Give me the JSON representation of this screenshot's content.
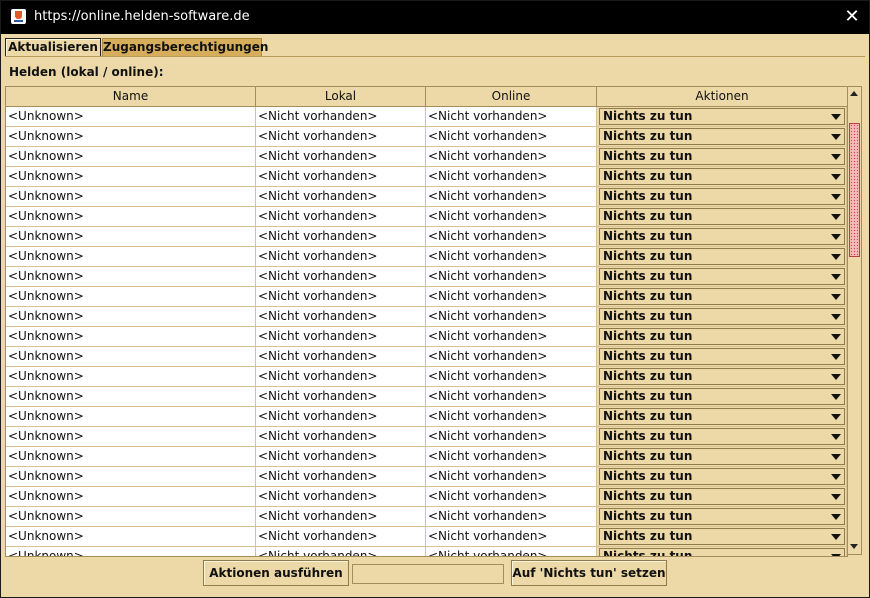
{
  "window": {
    "title": "https://online.helden-software.de"
  },
  "tabs": [
    {
      "label": "Aktualisieren",
      "active": true
    },
    {
      "label": "Zugangsberechtigungen",
      "active": false
    }
  ],
  "panel": {
    "label": "Helden (lokal / online):"
  },
  "table": {
    "columns": [
      "Name",
      "Lokal",
      "Online",
      "Aktionen"
    ],
    "rows": [
      {
        "name": "<Unknown>",
        "lokal": "<Nicht vorhanden>",
        "online": "<Nicht vorhanden>",
        "action": "Nichts zu tun"
      },
      {
        "name": "<Unknown>",
        "lokal": "<Nicht vorhanden>",
        "online": "<Nicht vorhanden>",
        "action": "Nichts zu tun"
      },
      {
        "name": "<Unknown>",
        "lokal": "<Nicht vorhanden>",
        "online": "<Nicht vorhanden>",
        "action": "Nichts zu tun"
      },
      {
        "name": "<Unknown>",
        "lokal": "<Nicht vorhanden>",
        "online": "<Nicht vorhanden>",
        "action": "Nichts zu tun"
      },
      {
        "name": "<Unknown>",
        "lokal": "<Nicht vorhanden>",
        "online": "<Nicht vorhanden>",
        "action": "Nichts zu tun"
      },
      {
        "name": "<Unknown>",
        "lokal": "<Nicht vorhanden>",
        "online": "<Nicht vorhanden>",
        "action": "Nichts zu tun"
      },
      {
        "name": "<Unknown>",
        "lokal": "<Nicht vorhanden>",
        "online": "<Nicht vorhanden>",
        "action": "Nichts zu tun"
      },
      {
        "name": "<Unknown>",
        "lokal": "<Nicht vorhanden>",
        "online": "<Nicht vorhanden>",
        "action": "Nichts zu tun"
      },
      {
        "name": "<Unknown>",
        "lokal": "<Nicht vorhanden>",
        "online": "<Nicht vorhanden>",
        "action": "Nichts zu tun"
      },
      {
        "name": "<Unknown>",
        "lokal": "<Nicht vorhanden>",
        "online": "<Nicht vorhanden>",
        "action": "Nichts zu tun"
      },
      {
        "name": "<Unknown>",
        "lokal": "<Nicht vorhanden>",
        "online": "<Nicht vorhanden>",
        "action": "Nichts zu tun"
      },
      {
        "name": "<Unknown>",
        "lokal": "<Nicht vorhanden>",
        "online": "<Nicht vorhanden>",
        "action": "Nichts zu tun"
      },
      {
        "name": "<Unknown>",
        "lokal": "<Nicht vorhanden>",
        "online": "<Nicht vorhanden>",
        "action": "Nichts zu tun"
      },
      {
        "name": "<Unknown>",
        "lokal": "<Nicht vorhanden>",
        "online": "<Nicht vorhanden>",
        "action": "Nichts zu tun"
      },
      {
        "name": "<Unknown>",
        "lokal": "<Nicht vorhanden>",
        "online": "<Nicht vorhanden>",
        "action": "Nichts zu tun"
      },
      {
        "name": "<Unknown>",
        "lokal": "<Nicht vorhanden>",
        "online": "<Nicht vorhanden>",
        "action": "Nichts zu tun"
      },
      {
        "name": "<Unknown>",
        "lokal": "<Nicht vorhanden>",
        "online": "<Nicht vorhanden>",
        "action": "Nichts zu tun"
      },
      {
        "name": "<Unknown>",
        "lokal": "<Nicht vorhanden>",
        "online": "<Nicht vorhanden>",
        "action": "Nichts zu tun"
      },
      {
        "name": "<Unknown>",
        "lokal": "<Nicht vorhanden>",
        "online": "<Nicht vorhanden>",
        "action": "Nichts zu tun"
      },
      {
        "name": "<Unknown>",
        "lokal": "<Nicht vorhanden>",
        "online": "<Nicht vorhanden>",
        "action": "Nichts zu tun"
      },
      {
        "name": "<Unknown>",
        "lokal": "<Nicht vorhanden>",
        "online": "<Nicht vorhanden>",
        "action": "Nichts zu tun"
      },
      {
        "name": "<Unknown>",
        "lokal": "<Nicht vorhanden>",
        "online": "<Nicht vorhanden>",
        "action": "Nichts zu tun"
      },
      {
        "name": "<Unknown>",
        "lokal": "<Nicht vorhanden>",
        "online": "<Nicht vorhanden>",
        "action": "Nichts zu tun"
      }
    ]
  },
  "buttons": {
    "execute": "Aktionen ausführen",
    "reset_all": "Auf 'Nichts tun' setzen"
  },
  "status_field": {
    "value": ""
  },
  "icons": {
    "app": "java-icon",
    "close": "close-icon"
  },
  "colors": {
    "panel": "#ecd9a7",
    "tab_inactive": "#d6ad5a",
    "scroll_thumb": "#f5b7b7"
  }
}
